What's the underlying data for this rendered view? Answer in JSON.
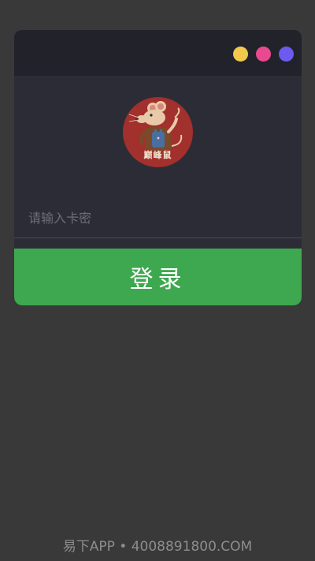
{
  "window": {
    "dots": [
      {
        "name": "yellow-dot",
        "color": "#f2c94c"
      },
      {
        "name": "pink-dot",
        "color": "#e94a8f"
      },
      {
        "name": "purple-dot",
        "color": "#6b5bef"
      }
    ]
  },
  "logo": {
    "text": "巅峰鼠",
    "icon": "rat-mascot-icon",
    "background_color": "#a2302d"
  },
  "form": {
    "card_input_placeholder": "请输入卡密",
    "card_input_value": "",
    "login_label": "登录",
    "login_color": "#3ea850"
  },
  "footer": {
    "text": "易下APP • 4008891800.COM"
  }
}
